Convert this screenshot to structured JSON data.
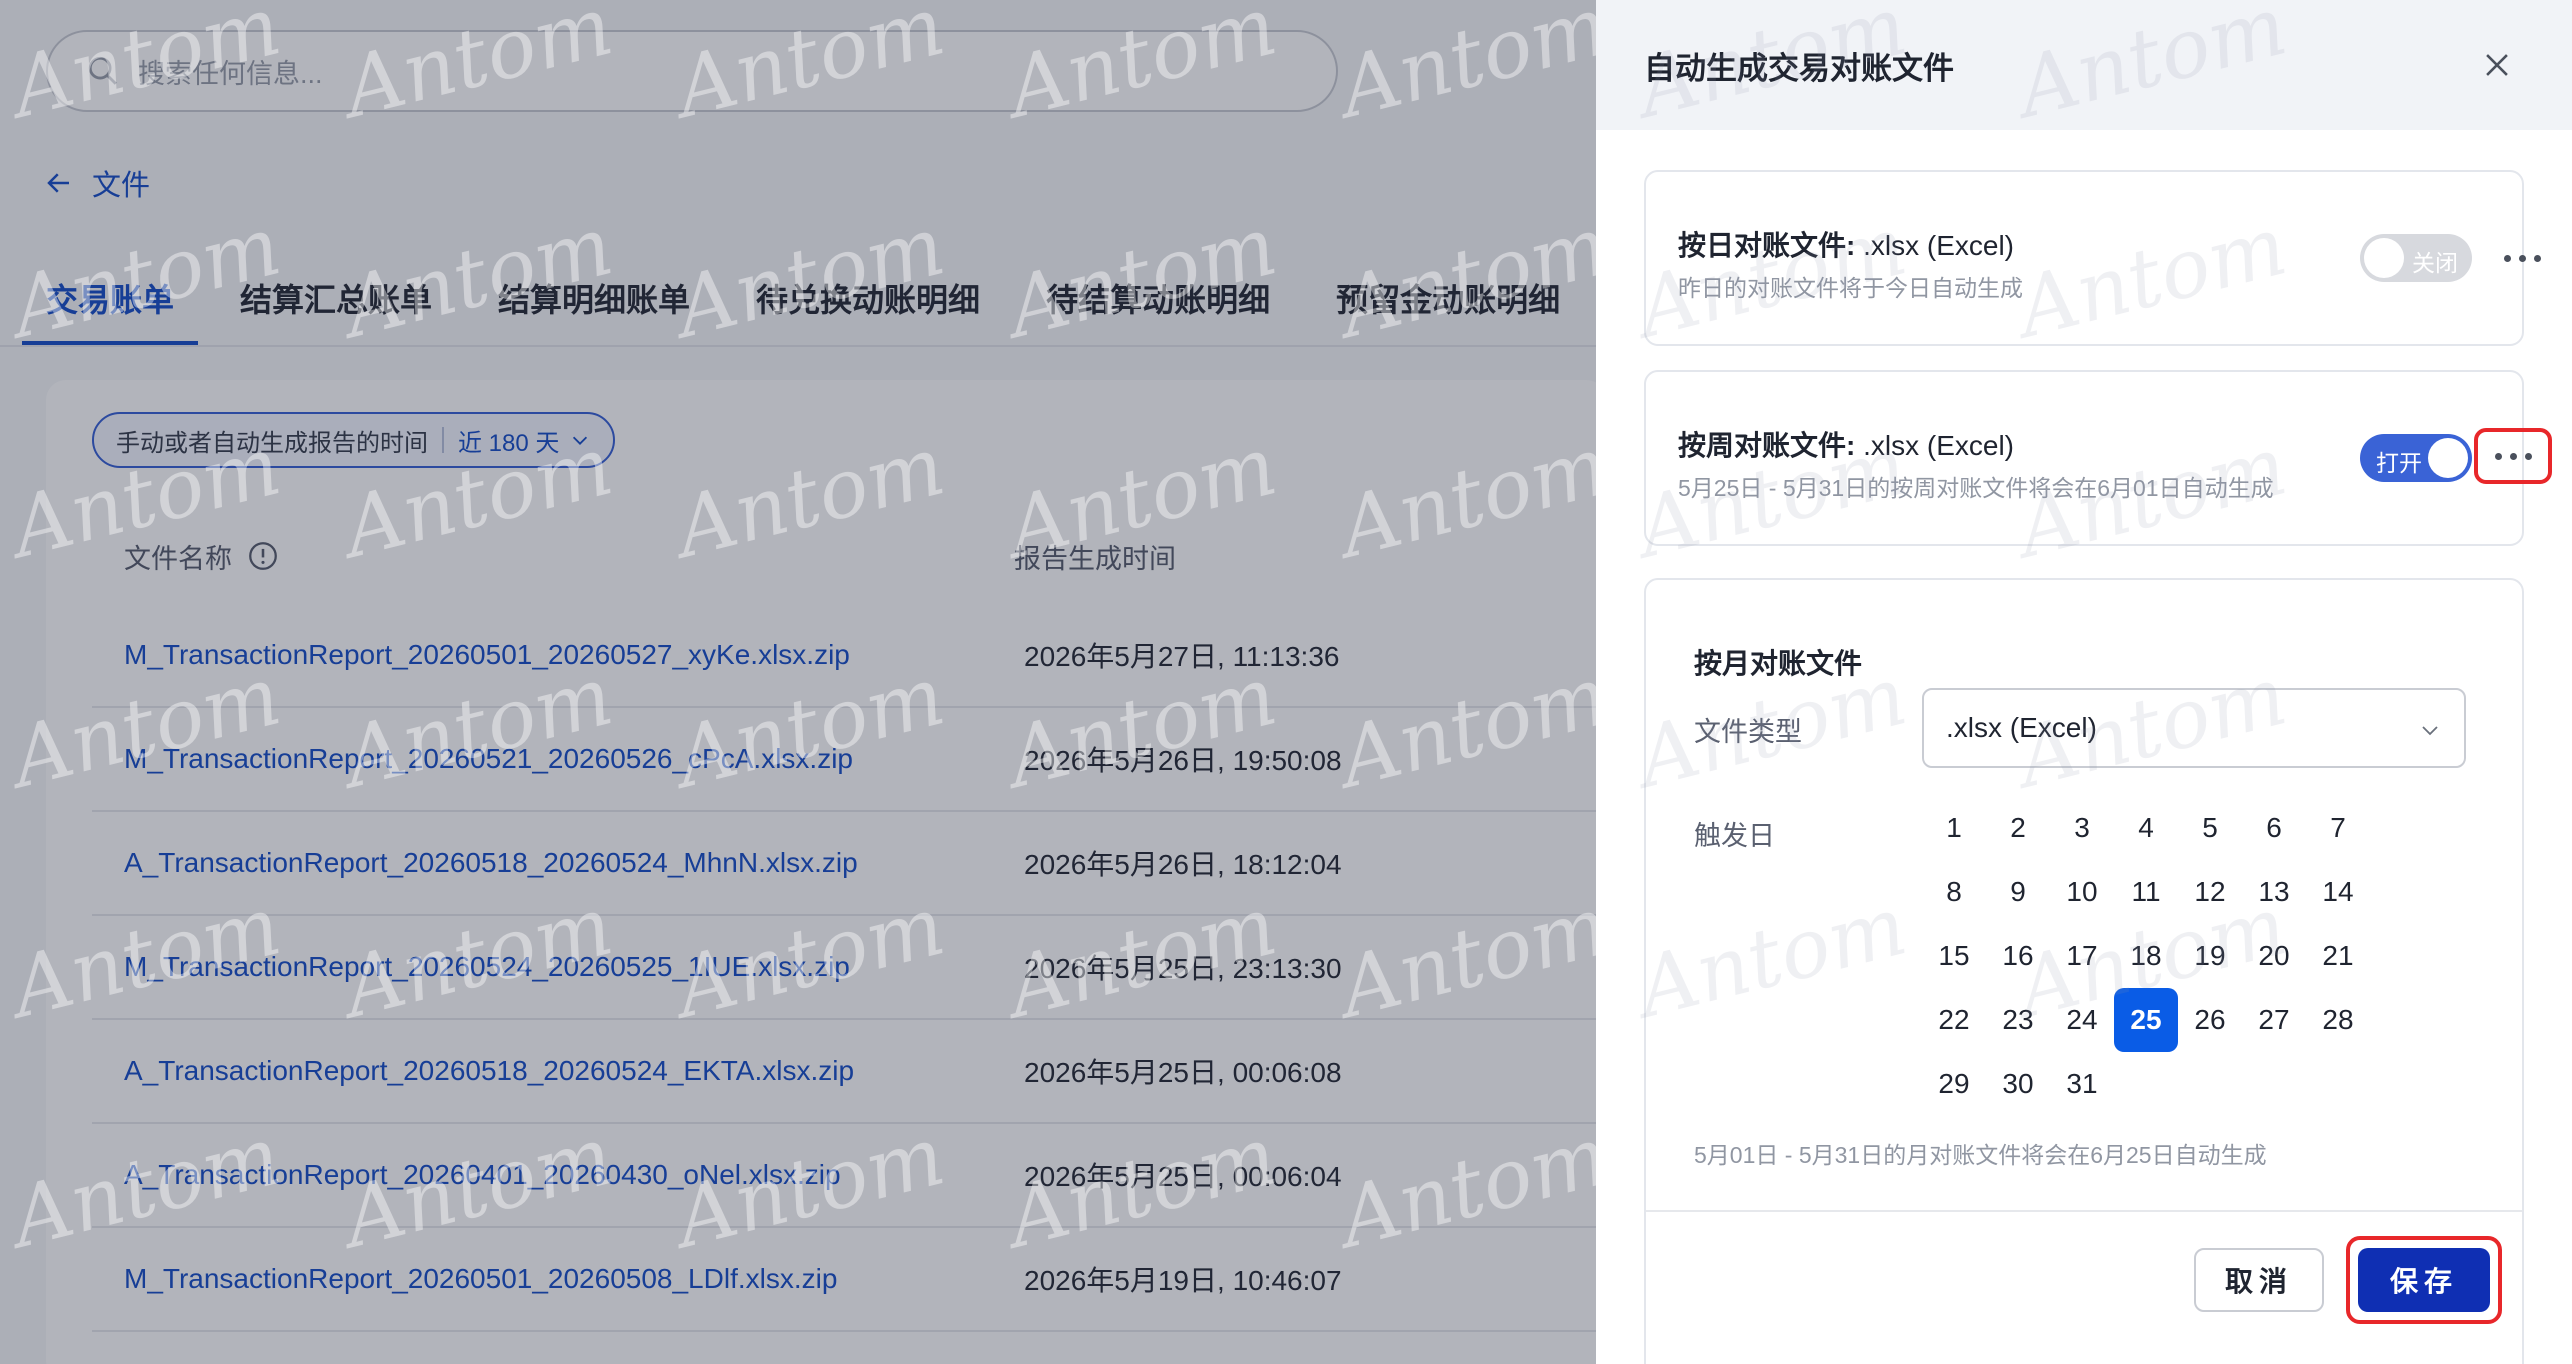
{
  "search": {
    "placeholder": "搜索任何信息..."
  },
  "back": {
    "label": "文件"
  },
  "tabs": [
    {
      "label": "交易账单",
      "active": true
    },
    {
      "label": "结算汇总账单",
      "active": false
    },
    {
      "label": "结算明细账单",
      "active": false
    },
    {
      "label": "待兑换动账明细",
      "active": false
    },
    {
      "label": "待结算动账明细",
      "active": false
    },
    {
      "label": "预留金动账明细",
      "active": false
    }
  ],
  "filter": {
    "label": "手动或者自动生成报告的时间",
    "value": "近 180 天"
  },
  "table": {
    "columns": [
      "文件名称",
      "报告生成时间"
    ],
    "rows": [
      {
        "name": "M_TransactionReport_20260501_20260527_xyKe.xlsx.zip",
        "time": "2026年5月27日, 11:13:36"
      },
      {
        "name": "M_TransactionReport_20260521_20260526_cPcA.xlsx.zip",
        "time": "2026年5月26日, 19:50:08"
      },
      {
        "name": "A_TransactionReport_20260518_20260524_MhnN.xlsx.zip",
        "time": "2026年5月26日, 18:12:04"
      },
      {
        "name": "M_TransactionReport_20260524_20260525_1IUE.xlsx.zip",
        "time": "2026年5月25日, 23:13:30"
      },
      {
        "name": "A_TransactionReport_20260518_20260524_EKTA.xlsx.zip",
        "time": "2026年5月25日, 00:06:08"
      },
      {
        "name": "A_TransactionReport_20260401_20260430_oNel.xlsx.zip",
        "time": "2026年5月25日, 00:06:04"
      },
      {
        "name": "M_TransactionReport_20260501_20260508_LDlf.xlsx.zip",
        "time": "2026年5月19日, 10:46:07"
      }
    ]
  },
  "drawer": {
    "title": "自动生成交易对账文件",
    "daily": {
      "title": "按日对账文件:",
      "format": ".xlsx (Excel)",
      "desc": "昨日的对账文件将于今日自动生成",
      "toggle": "关闭",
      "enabled": false
    },
    "weekly": {
      "title": "按周对账文件:",
      "format": ".xlsx (Excel)",
      "desc": "5月25日 - 5月31日的按周对账文件将会在6月01日自动生成",
      "toggle": "打开",
      "enabled": true
    },
    "monthly": {
      "title": "按月对账文件",
      "type_label": "文件类型",
      "type_value": ".xlsx (Excel)",
      "day_label": "触发日",
      "days": [
        "1",
        "2",
        "3",
        "4",
        "5",
        "6",
        "7",
        "8",
        "9",
        "10",
        "11",
        "12",
        "13",
        "14",
        "15",
        "16",
        "17",
        "18",
        "19",
        "20",
        "21",
        "22",
        "23",
        "24",
        "25",
        "26",
        "27",
        "28",
        "29",
        "30",
        "31"
      ],
      "selected_day": "25",
      "note": "5月01日 - 5月31日的月对账文件将会在6月25日自动生成"
    },
    "cancel": "取消",
    "save": "保存"
  },
  "watermark": "Antom",
  "colors": {
    "accent": "#1b52c9",
    "save": "#0f2fb3",
    "selected_day": "#0a5ce6",
    "highlight": "#e8272a"
  }
}
